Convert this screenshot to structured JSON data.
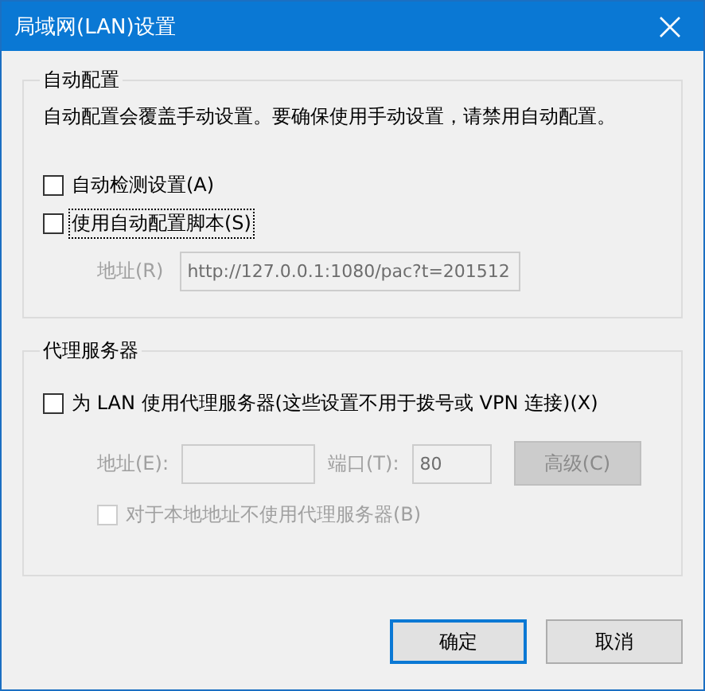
{
  "window": {
    "title": "局域网(LAN)设置"
  },
  "auto_config": {
    "title": "自动配置",
    "note": "自动配置会覆盖手动设置。要确保使用手动设置，请禁用自动配置。",
    "options": [
      {
        "label": "自动检测设置(A)",
        "checked": false,
        "focused": false
      },
      {
        "label": "使用自动配置脚本(S)",
        "checked": false,
        "focused": true
      }
    ],
    "address": {
      "label": "地址(R)",
      "value": "http://127.0.0.1:1080/pac?t=201512",
      "disabled": true
    }
  },
  "proxy": {
    "title": "代理服务器",
    "use_proxy": {
      "label": "为 LAN 使用代理服务器(这些设置不用于拨号或 VPN 连接)(X)",
      "checked": false
    },
    "address": {
      "label": "地址(E):",
      "disabled": true
    },
    "port": {
      "label": "端口(T):",
      "value": "80",
      "disabled": true
    },
    "advanced": {
      "label": "高级(C)",
      "disabled": true
    },
    "bypass": {
      "label": "对于本地地址不使用代理服务器(B)",
      "checked": false,
      "disabled": true
    }
  },
  "buttons": [
    {
      "label": "确定",
      "default": true
    },
    {
      "label": "取消",
      "default": false
    }
  ]
}
